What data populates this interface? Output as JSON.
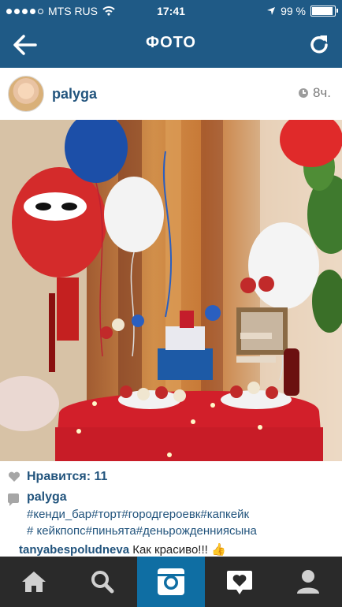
{
  "status_bar": {
    "carrier": "MTS RUS",
    "time": "17:41",
    "battery": "99 %",
    "battery_level": 0.99
  },
  "nav": {
    "title": "ФОТО"
  },
  "post": {
    "username": "palyga",
    "time_ago": "8ч.",
    "likes_text": "Нравится: 11",
    "caption_author": "palyga",
    "caption_lines": [
      "#кенди_бар#торт#городгероевк#капкейк",
      "# кейкпопс#пиньята#деньрожденниясына"
    ],
    "comment": {
      "author": "tanyabespoludneva",
      "text": "Как красиво!!! 👍"
    }
  },
  "tabs": [
    {
      "name": "home-icon"
    },
    {
      "name": "search-icon"
    },
    {
      "name": "camera-icon",
      "active": true
    },
    {
      "name": "activity-icon"
    },
    {
      "name": "profile-icon"
    }
  ],
  "colors": {
    "nav_bg": "#1f5a86",
    "tab_bg": "#2a2a2a",
    "tab_active": "#0f6ea3",
    "username": "#22547d"
  }
}
